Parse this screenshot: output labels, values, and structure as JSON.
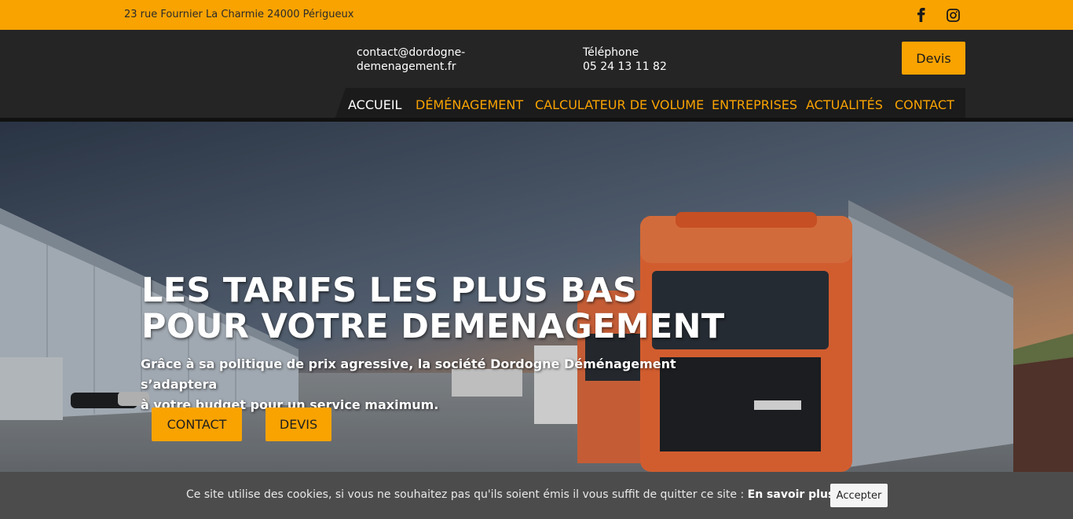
{
  "topbar": {
    "address": "23 rue Fournier La Charmie 24000 Périgueux",
    "social": [
      "facebook-icon",
      "instagram-icon"
    ]
  },
  "header": {
    "email": "contact@dordogne-demenagement.fr",
    "phone_label": "Téléphone",
    "phone_number": "05 24 13 11 82",
    "devis_label": "Devis"
  },
  "nav": {
    "items": [
      "ACCUEIL",
      "DÉMÉNAGEMENT",
      "CALCULATEUR DE VOLUME",
      "ENTREPRISES",
      "ACTUALITÉS",
      "CONTACT"
    ],
    "active": "ACCUEIL"
  },
  "hero": {
    "title_line1": "LES TARIFS LES PLUS BAS",
    "title_line2": "POUR VOTRE DEMENAGEMENT",
    "text_line1": "Grâce à sa politique de prix agressive, la société Dordogne Déménagement s’adaptera",
    "text_line2": "à votre budget pour un service maximum.",
    "button_contact": "CONTACT",
    "button_devis": "DEVIS"
  },
  "cookie": {
    "message": "Ce site utilise des cookies, si vous ne souhaitez pas qu'ils soient émis il vous suffit de quitter ce site : ",
    "more_link": "En savoir plus.",
    "accept": "Accepter"
  },
  "colors": {
    "accent": "#f9a301",
    "header_bg": "#252525",
    "nav_bg": "#1b1b1b",
    "cookie_bg": "#4c4c4c"
  }
}
